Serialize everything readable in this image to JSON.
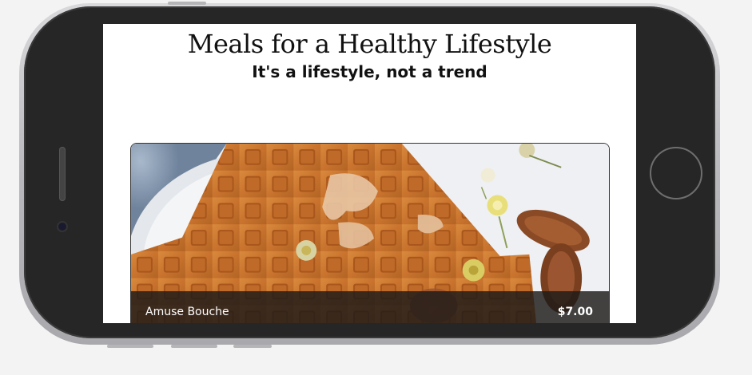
{
  "page": {
    "title": "Meals for a Healthy Lifestyle",
    "subtitle": "It's a lifestyle, not a trend"
  },
  "menu_items": [
    {
      "name": "Amuse Bouche",
      "price": "$7.00"
    }
  ],
  "device": {
    "frame_color": "#262626",
    "screen_color": "#ffffff"
  }
}
